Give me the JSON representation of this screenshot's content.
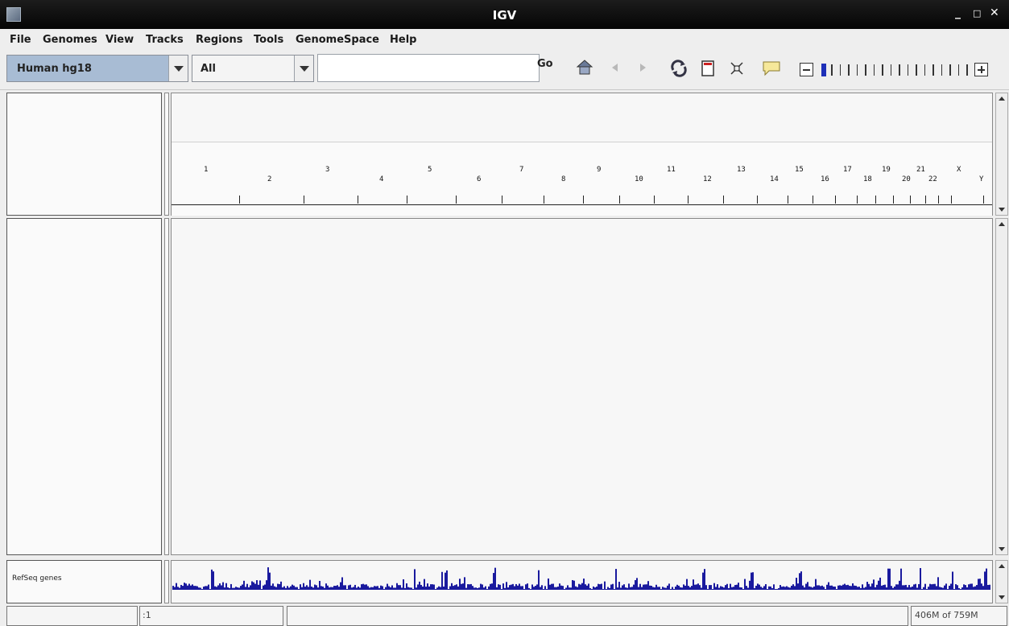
{
  "window": {
    "title": "IGV"
  },
  "menu": [
    "File",
    "Genomes",
    "View",
    "Tracks",
    "Regions",
    "Tools",
    "GenomeSpace",
    "Help"
  ],
  "toolbar": {
    "genome": "Human hg18",
    "chromosome": "All",
    "locus_value": "",
    "go_label": "Go",
    "icons": [
      "home-icon",
      "back-icon",
      "forward-icon",
      "refresh-icon",
      "region-of-interest-icon",
      "resize-to-window-icon",
      "popup-info-icon"
    ]
  },
  "ideogram": {
    "chromosomes": [
      "1",
      "2",
      "3",
      "4",
      "5",
      "6",
      "7",
      "8",
      "9",
      "10",
      "11",
      "12",
      "13",
      "14",
      "15",
      "16",
      "17",
      "18",
      "19",
      "20",
      "21",
      "22",
      "X",
      "Y"
    ]
  },
  "tracks": {
    "feature_track_name": "RefSeq genes",
    "density_color": "#1a1a9e"
  },
  "status": {
    "position": ":1",
    "memory": "406M of 759M"
  },
  "colors": {
    "accent": "#1a1a9e",
    "genome_combo_bg": "#a8bcd4"
  }
}
